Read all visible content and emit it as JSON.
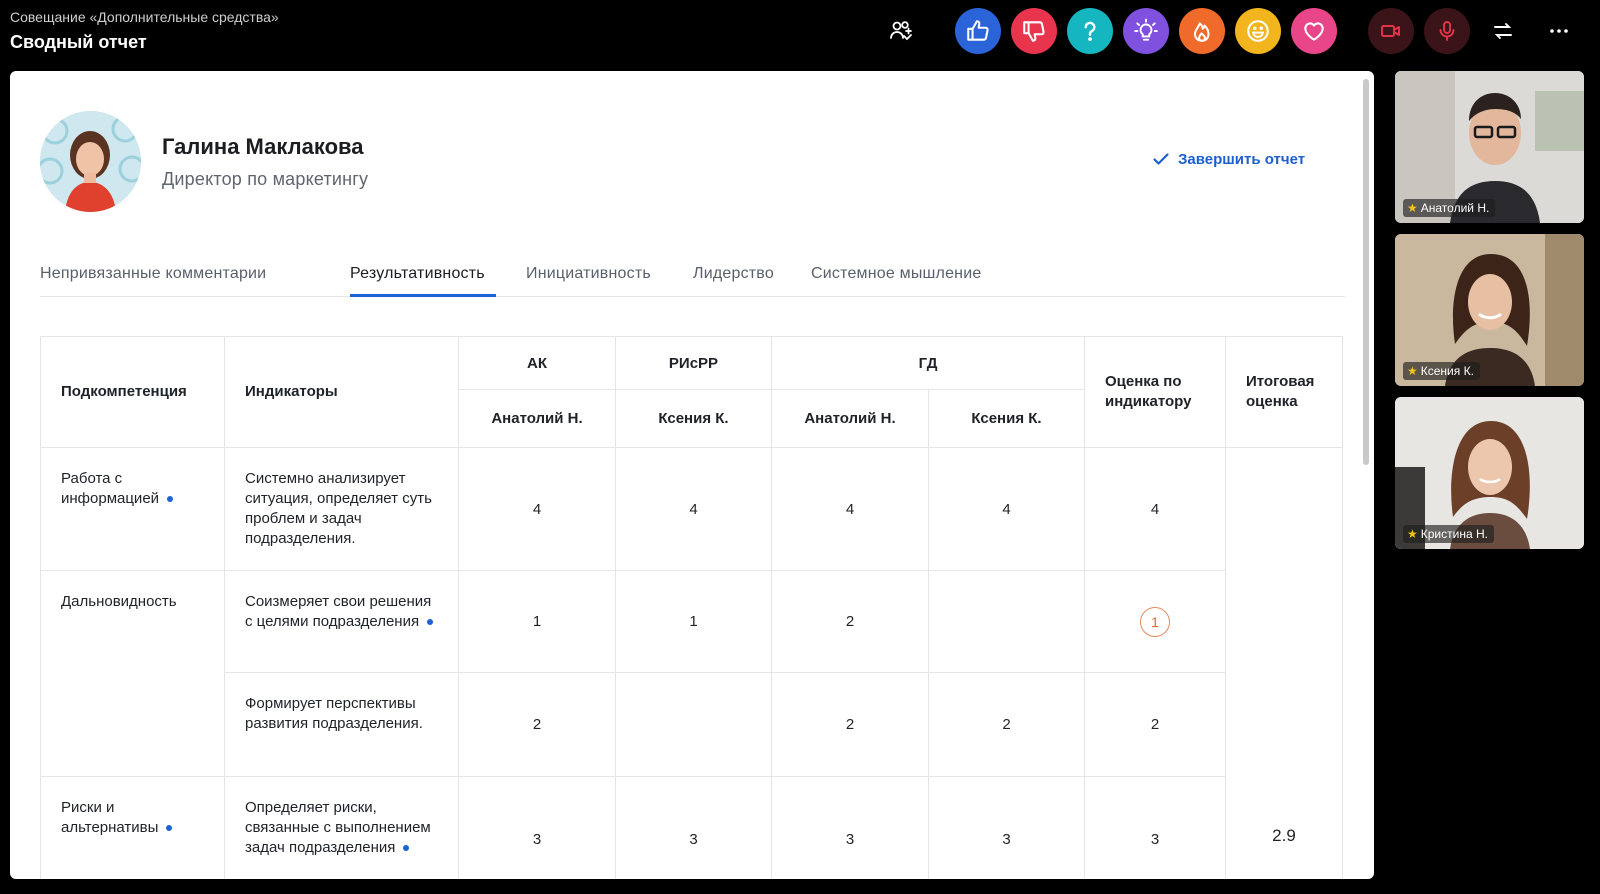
{
  "meeting": {
    "subtitle": "Совещание «Дополнительные средства»",
    "title": "Сводный отчет"
  },
  "toolbar": {
    "participants_icon": "people-icon",
    "reactions": [
      {
        "icon": "thumbs-up-icon",
        "color": "#2b63d9"
      },
      {
        "icon": "thumbs-down-icon",
        "color": "#e8354d"
      },
      {
        "icon": "question-icon",
        "color": "#16b6c0"
      },
      {
        "icon": "lightbulb-icon",
        "color": "#8050de"
      },
      {
        "icon": "fire-icon",
        "color": "#f06a2b"
      },
      {
        "icon": "smile-icon",
        "color": "#f2b51d"
      },
      {
        "icon": "heart-icon",
        "color": "#e9468a"
      }
    ],
    "camera_icon": "camera-off-icon",
    "mic_icon": "mic-icon",
    "layout_icon": "layout-switch-icon",
    "more_icon": "more-icon",
    "control_bg": "#3a1418",
    "control_fg": "#e5344a"
  },
  "person": {
    "name": "Галина Маклакова",
    "role": "Директор по маркетингу"
  },
  "actions": {
    "finish": "Завершить отчет"
  },
  "tabs": [
    {
      "label": "Непривязанные комментарии"
    },
    {
      "label": "Результативность",
      "active": true
    },
    {
      "label": "Инициативность"
    },
    {
      "label": "Лидерство"
    },
    {
      "label": "Системное мышление"
    }
  ],
  "table": {
    "headers": {
      "subcompetence": "Подкомпетенция",
      "indicators": "Индикаторы",
      "group_ak": "АК",
      "group_risrr": "РИсРР",
      "group_gd": "ГД",
      "indicator_score": "Оценка по индикатору",
      "final_score": "Итоговая оценка",
      "sub_ak_1": "Анатолий Н.",
      "sub_risrr_1": "Ксения К.",
      "sub_gd_1": "Анатолий Н.",
      "sub_gd_2": "Ксения К."
    },
    "rows": [
      {
        "sub": "Работа с информацией",
        "indicator": "Системно анализирует ситуация, определяет суть проблем и задач подразделения.",
        "ak": "4",
        "risrr": "4",
        "gd1": "4",
        "gd2": "4",
        "score": "4"
      },
      {
        "sub": "Дальновидность",
        "indicator": "Соизмеряет свои решения с целями подразделения",
        "ak": "1",
        "risrr": "1",
        "gd1": "2",
        "gd2": "",
        "score": "1"
      },
      {
        "sub": "",
        "indicator": "Формирует перспективы развития подразделения.",
        "ak": "2",
        "risrr": "",
        "gd1": "2",
        "gd2": "2",
        "score": "2"
      },
      {
        "sub": "Риски и альтернативы",
        "indicator": "Определяет риски, связанные с выполнением задач подразделения",
        "ak": "3",
        "risrr": "3",
        "gd1": "3",
        "gd2": "3",
        "score": "3"
      }
    ],
    "final": "2.9"
  },
  "participants": [
    {
      "name": "Анатолий Н."
    },
    {
      "name": "Ксения К."
    },
    {
      "name": "Кристина Н."
    }
  ]
}
